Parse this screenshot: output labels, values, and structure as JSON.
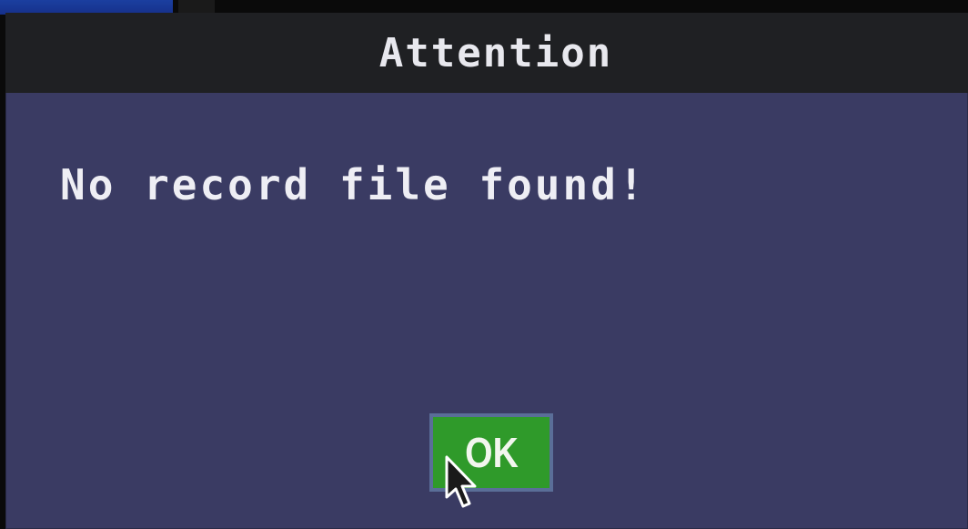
{
  "dialog": {
    "title": "Attention",
    "message": "No record file found!",
    "ok_label": "OK"
  },
  "icons": {
    "cursor": "mouse-pointer-icon"
  },
  "colors": {
    "titlebar": "#1f2023",
    "dialog_body": "#3a3b63",
    "ok_button": "#2f9a2a",
    "text": "#eeeef4"
  }
}
